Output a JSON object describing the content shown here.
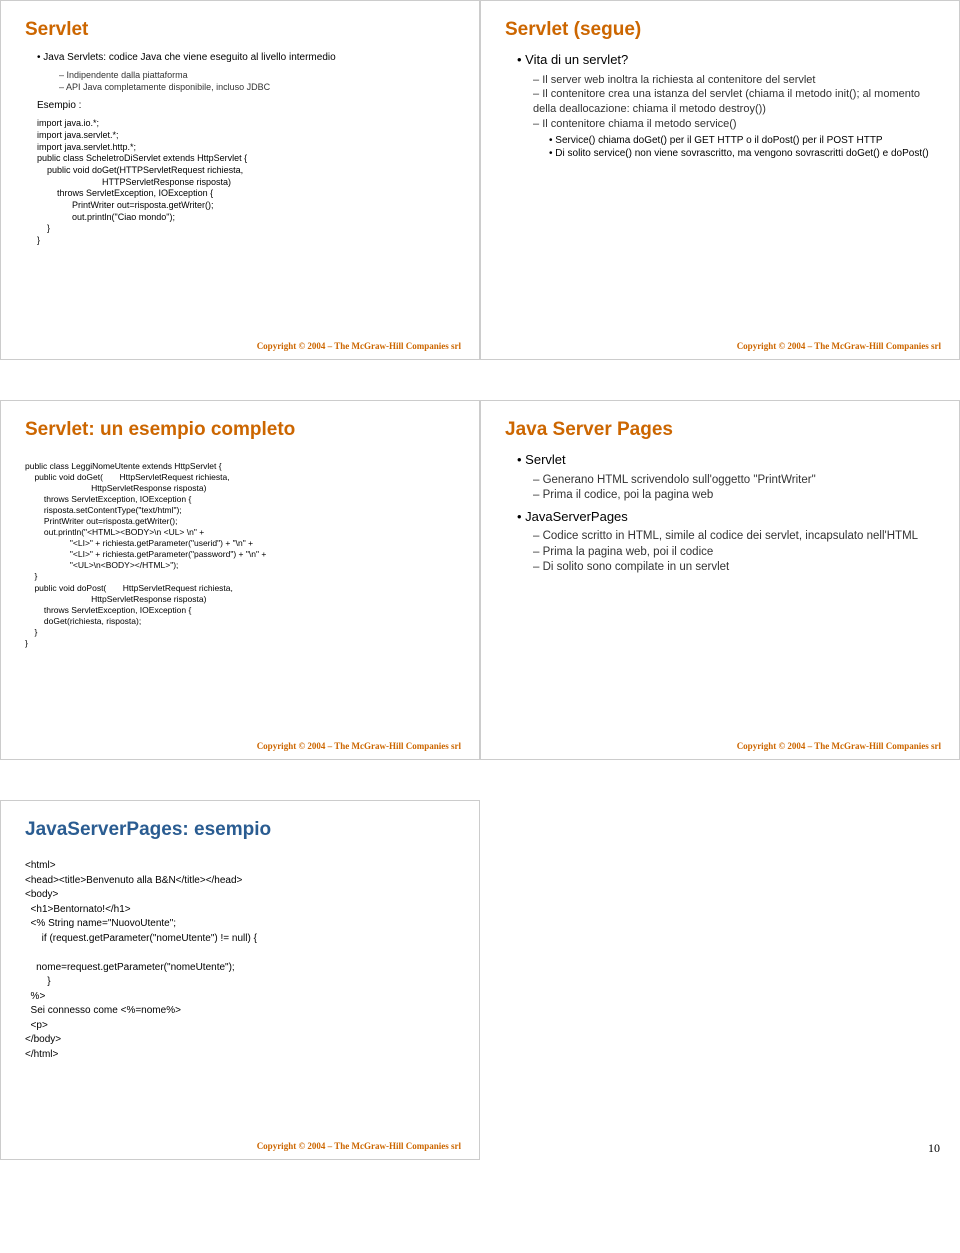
{
  "slides": {
    "s1": {
      "title": "Servlet",
      "bullet1": "Java Servlets: codice Java che viene eseguito al livello intermedio",
      "sub1": "Indipendente dalla piattaforma",
      "sub2": "API Java completamente disponibile, incluso JDBC",
      "esempio": "Esempio :",
      "code": "import java.io.*;\nimport java.servlet.*;\nimport java.servlet.http.*;\npublic class ScheletroDiServlet extends HttpServlet {\n    public void doGet(HTTPServletRequest richiesta,\n                          HTTPServletResponse risposta)\n        throws ServletException, IOException {\n              PrintWriter out=risposta.getWriter();\n              out.println(\"Ciao mondo\");\n    }\n}"
    },
    "s2": {
      "title": "Servlet (segue)",
      "b1": "Vita di un servlet?",
      "s1": "Il server web inoltra la richiesta al contenitore del servlet",
      "s2": "Il contenitore crea una istanza del servlet (chiama il metodo init(); al momento della deallocazione: chiama il metodo destroy())",
      "s3": "Il contenitore chiama il metodo service()",
      "ss1": "Service() chiama doGet() per il GET HTTP o il doPost() per il POST HTTP",
      "ss2": "Di solito service() non viene sovrascritto, ma vengono sovrascritti doGet() e doPost()"
    },
    "s3": {
      "title": "Servlet: un esempio completo",
      "code": "public class LeggiNomeUtente extends HttpServlet {\n    public void doGet(       HttpServletRequest richiesta,\n                            HttpServletResponse risposta)\n        throws ServletException, IOException {\n        risposta.setContentType(\"text/html\");\n        PrintWriter out=risposta.getWriter();\n        out.println(\"<HTML><BODY>\\n <UL> \\n\" +\n                   \"<LI>\" + richiesta.getParameter(\"userid\") + \"\\n\" +\n                   \"<LI>\" + richiesta.getParameter(\"password\") + \"\\n\" +\n                   \"<UL>\\n<BODY></HTML>\");\n    }\n    public void doPost(       HttpServletRequest richiesta,\n                            HttpServletResponse risposta)\n        throws ServletException, IOException {\n        doGet(richiesta, risposta);\n    }\n}"
    },
    "s4": {
      "title": "Java Server Pages",
      "b1": "Servlet",
      "s1": "Generano HTML scrivendolo sull'oggetto \"PrintWriter\"",
      "s2": "Prima il codice, poi la pagina web",
      "b2": "JavaServerPages",
      "s3": "Codice scritto in HTML, simile al codice dei servlet, incapsulato nell'HTML",
      "s4": "Prima la pagina web, poi il codice",
      "s5": "Di solito sono compilate in un servlet"
    },
    "s5": {
      "title": "JavaServerPages: esempio",
      "code": "<html>\n<head><title>Benvenuto alla B&N</title></head>\n<body>\n  <h1>Bentornato!</h1>\n  <% String name=\"NuovoUtente\";\n      if (request.getParameter(\"nomeUtente\") != null) {\n\n    nome=request.getParameter(\"nomeUtente\");\n        }\n  %>\n  Sei connesso come <%=nome%>\n  <p>\n</body>\n</html>"
    }
  },
  "footer": "Copyright © 2004 – The McGraw-Hill Companies srl",
  "page_number": "10"
}
